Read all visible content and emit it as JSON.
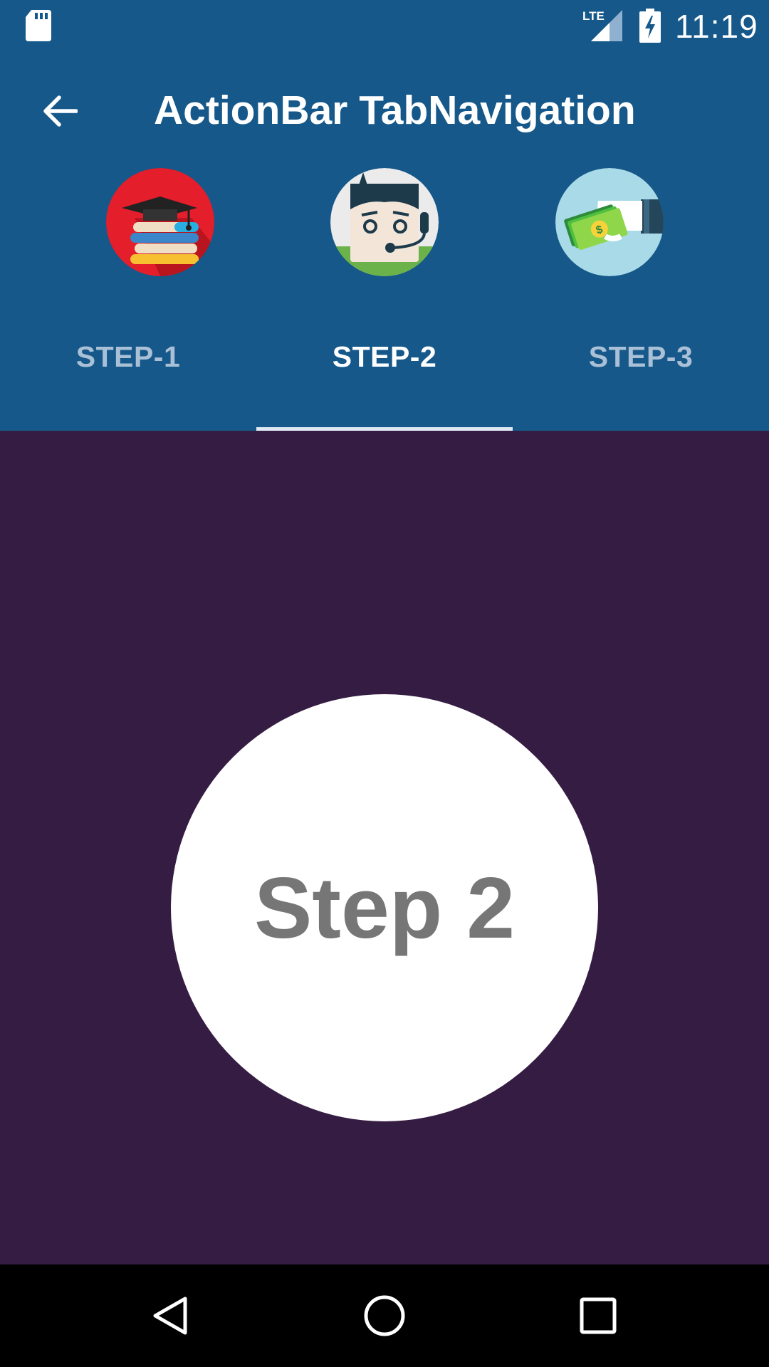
{
  "status_bar": {
    "time": "11:19",
    "network": "LTE",
    "icons": [
      "sd-card-icon",
      "lte-signal-icon",
      "battery-charging-icon"
    ]
  },
  "action_bar": {
    "title": "ActionBar TabNavigation",
    "back_icon": "arrow-back-icon",
    "background_color": "#155889"
  },
  "tabs": [
    {
      "label": "STEP-1",
      "icon": "graduation-books-icon",
      "selected": false
    },
    {
      "label": "STEP-2",
      "icon": "support-agent-icon",
      "selected": true
    },
    {
      "label": "STEP-3",
      "icon": "money-hand-icon",
      "selected": false
    }
  ],
  "content": {
    "step_text": "Step 2",
    "background_color": "#351c43"
  },
  "nav_bar": {
    "icons": [
      "back-triangle-icon",
      "home-circle-icon",
      "recents-square-icon"
    ]
  }
}
